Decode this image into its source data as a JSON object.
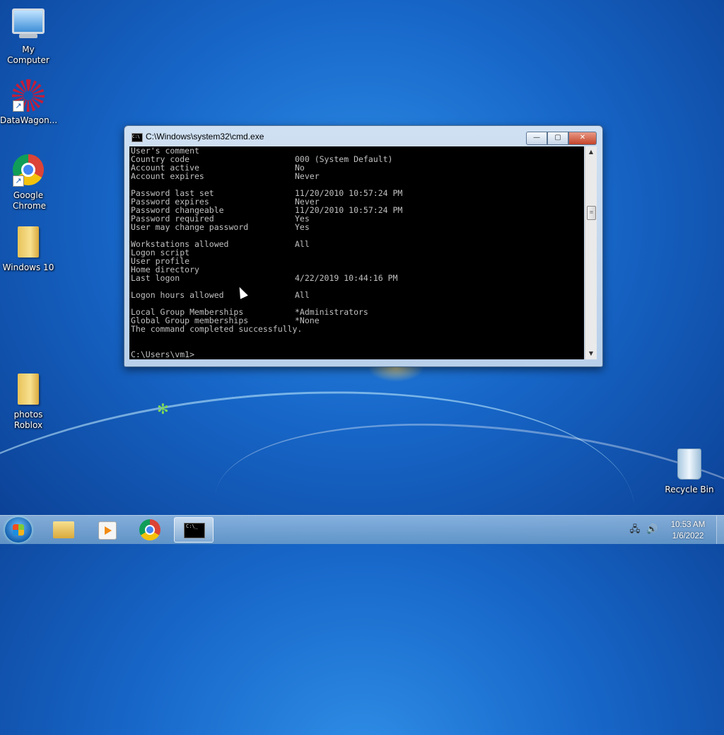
{
  "desktop": {
    "icons": [
      {
        "label": "My Computer"
      },
      {
        "label": "DataWagon..."
      },
      {
        "label": "Google Chrome"
      },
      {
        "label": "Windows 10"
      },
      {
        "label": "photos Roblox"
      },
      {
        "label": "Recycle Bin"
      }
    ]
  },
  "cmd": {
    "title": "C:\\Windows\\system32\\cmd.exe",
    "title_icon_text": "C:\\",
    "lines": [
      {
        "key": "User's comment",
        "value": ""
      },
      {
        "key": "Country code",
        "value": "000 (System Default)"
      },
      {
        "key": "Account active",
        "value": "No"
      },
      {
        "key": "Account expires",
        "value": "Never"
      },
      {
        "key": "",
        "value": ""
      },
      {
        "key": "Password last set",
        "value": "11/20/2010 10:57:24 PM"
      },
      {
        "key": "Password expires",
        "value": "Never"
      },
      {
        "key": "Password changeable",
        "value": "11/20/2010 10:57:24 PM"
      },
      {
        "key": "Password required",
        "value": "Yes"
      },
      {
        "key": "User may change password",
        "value": "Yes"
      },
      {
        "key": "",
        "value": ""
      },
      {
        "key": "Workstations allowed",
        "value": "All"
      },
      {
        "key": "Logon script",
        "value": ""
      },
      {
        "key": "User profile",
        "value": ""
      },
      {
        "key": "Home directory",
        "value": ""
      },
      {
        "key": "Last logon",
        "value": "4/22/2019 10:44:16 PM"
      },
      {
        "key": "",
        "value": ""
      },
      {
        "key": "Logon hours allowed",
        "value": "All"
      },
      {
        "key": "",
        "value": ""
      },
      {
        "key": "Local Group Memberships",
        "value": "*Administrators"
      },
      {
        "key": "Global Group memberships",
        "value": "*None"
      },
      {
        "key": "The command completed successfully.",
        "value": ""
      },
      {
        "key": "",
        "value": ""
      },
      {
        "key": "",
        "value": ""
      },
      {
        "key": "C:\\Users\\vm1>",
        "value": ""
      }
    ],
    "buttons": {
      "minimize": "—",
      "maximize": "▢",
      "close": "✕"
    }
  },
  "taskbar": {
    "cmd_icon_text": "C:\\_",
    "clock": {
      "time": "10:53 AM",
      "date": "1/6/2022"
    }
  }
}
